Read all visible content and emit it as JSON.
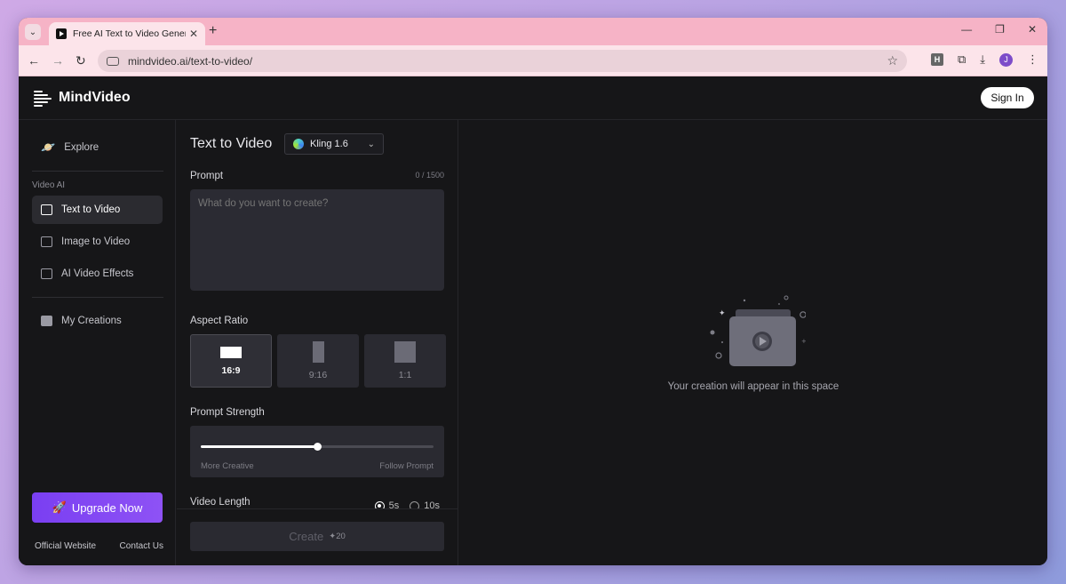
{
  "browser": {
    "tab_title": "Free AI Text to Video Generator",
    "url": "mindvideo.ai/text-to-video/",
    "profile_initial": "J",
    "extension_label": "H"
  },
  "app": {
    "brand": "MindVideo",
    "sign_in_label": "Sign In"
  },
  "sidebar": {
    "explore_label": "Explore",
    "section_label": "Video AI",
    "items": [
      {
        "label": "Text to Video",
        "active": true
      },
      {
        "label": "Image to Video",
        "active": false
      },
      {
        "label": "AI Video Effects",
        "active": false
      }
    ],
    "my_creations_label": "My Creations",
    "upgrade_label": "Upgrade Now",
    "links": {
      "official_website": "Official Website",
      "contact_us": "Contact Us"
    }
  },
  "panel": {
    "title": "Text to Video",
    "model": "Kling 1.6",
    "prompt_label": "Prompt",
    "prompt_counter": "0 / 1500",
    "prompt_placeholder": "What do you want to create?",
    "aspect_label": "Aspect Ratio",
    "ratios": [
      {
        "label": "16:9",
        "selected": true
      },
      {
        "label": "9:16",
        "selected": false
      },
      {
        "label": "1:1",
        "selected": false
      }
    ],
    "strength_label": "Prompt Strength",
    "strength_value": 0.5,
    "strength_left": "More Creative",
    "strength_right": "Follow Prompt",
    "length_label": "Video Length",
    "length_options": [
      {
        "label": "5s",
        "checked": true
      },
      {
        "label": "10s",
        "checked": false
      }
    ],
    "create_label": "Create",
    "create_cost": "20"
  },
  "preview": {
    "empty_text": "Your creation will appear in this space"
  },
  "colors": {
    "accent": "#7a3ff2",
    "background": "#161618",
    "tabbar": "#f6b3c6"
  }
}
